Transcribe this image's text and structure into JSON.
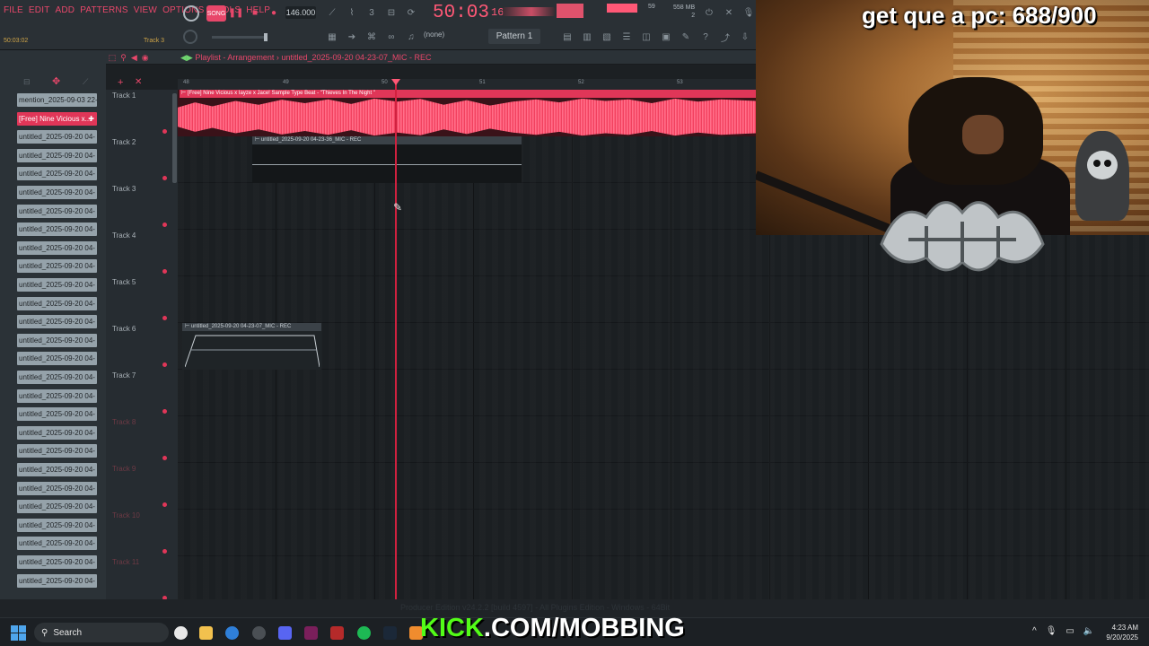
{
  "menu": [
    "FILE",
    "EDIT",
    "ADD",
    "PATTERNS",
    "VIEW",
    "OPTIONS",
    "TOOLS",
    "HELP"
  ],
  "transport": {
    "song_label": "SONG",
    "tempo": "146.000",
    "time_main": "50:03",
    "time_sub": "16",
    "hint_time": "50:03:02",
    "hint_track": "Track 3",
    "cpu_value": "59",
    "memory": "558 MB",
    "memory_sub": "2",
    "pattern": "Pattern 1",
    "none_label": "(none)"
  },
  "playlist": {
    "title": "Playlist - Arrangement",
    "sep": "›",
    "file": "untitled_2025-09-20 04-23-07_MIC - REC",
    "ruler": [
      "48",
      "49",
      "50",
      "51",
      "52",
      "53"
    ]
  },
  "browser": {
    "items": [
      "mention_2025-09-03 22-",
      "[Free] Nine Vicious x...",
      "untitled_2025-09-20 04-",
      "untitled_2025-09-20 04-",
      "untitled_2025-09-20 04-",
      "untitled_2025-09-20 04-",
      "untitled_2025-09-20 04-",
      "untitled_2025-09-20 04-",
      "untitled_2025-09-20 04-",
      "untitled_2025-09-20 04-",
      "untitled_2025-09-20 04-",
      "untitled_2025-09-20 04-",
      "untitled_2025-09-20 04-",
      "untitled_2025-09-20 04-",
      "untitled_2025-09-20 04-",
      "untitled_2025-09-20 04-",
      "untitled_2025-09-20 04-",
      "untitled_2025-09-20 04-",
      "untitled_2025-09-20 04-",
      "untitled_2025-09-20 04-",
      "untitled_2025-09-20 04-",
      "untitled_2025-09-20 04-",
      "untitled_2025-09-20 04-",
      "untitled_2025-09-20 04-",
      "untitled_2025-09-20 04-",
      "untitled_2025-09-20 04-",
      "untitled_2025-09-20 04-"
    ],
    "selected_index": 1
  },
  "tracks": [
    "Track 1",
    "Track 2",
    "Track 3",
    "Track 4",
    "Track 5",
    "Track 6",
    "Track 7",
    "Track 8",
    "Track 9",
    "Track 10",
    "Track 11"
  ],
  "clips": {
    "beat": "[Free] Nine Vicious x Iayze x Jace! Sample Type Beat - \"Thieves In The Night \"",
    "rec1": "untitled_2025-09-20 04-23-36_MIC - REC",
    "rec2": "untitled_2025-09-20 04-23-07_MIC - REC"
  },
  "overlay": {
    "goal": "get que a pc: 688/900",
    "kick_prefix": "KICK",
    "kick_rest": ".COM/MOBBING"
  },
  "status": "Producer Edition v24.2.2 [build 4597] - All Plugins Edition - Windows - 64Bit",
  "taskbar": {
    "search": "Search",
    "time": "4:23 AM",
    "date": "9/20/2025"
  },
  "colors": {
    "accent": "#e8476a",
    "playhead": "#d0213f",
    "kick_green": "#53fc18"
  }
}
